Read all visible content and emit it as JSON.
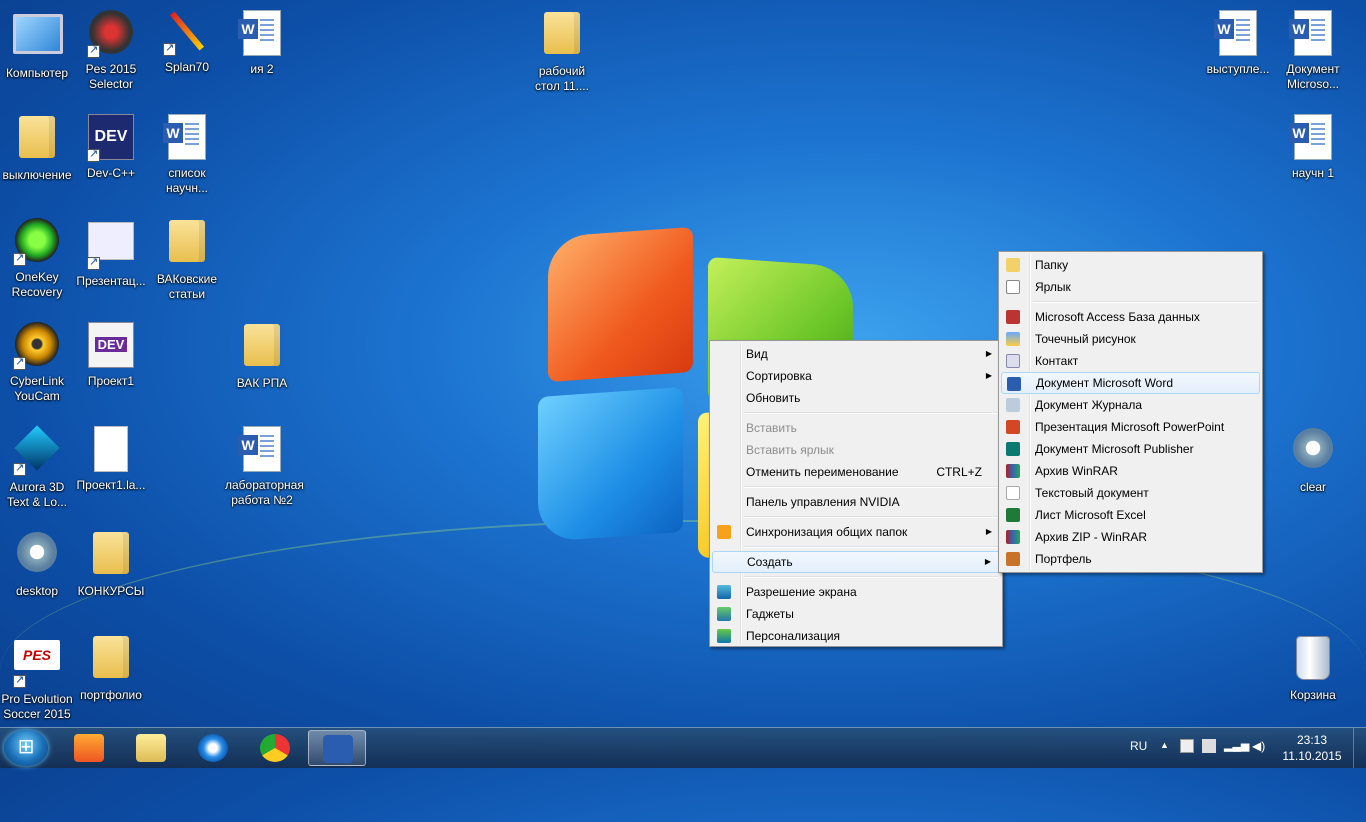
{
  "desktop": {
    "icons": [
      {
        "label": "Компьютер"
      },
      {
        "label": "Pes 2015 Selector"
      },
      {
        "label": "Splan70"
      },
      {
        "label": "ия 2"
      },
      {
        "label": "рабочий стол 11...."
      },
      {
        "label": "выступле..."
      },
      {
        "label": "Документ Microso..."
      },
      {
        "label": "выключение"
      },
      {
        "label": "Dev-C++"
      },
      {
        "label": "список научн..."
      },
      {
        "label": "научн 1"
      },
      {
        "label": "OneKey Recovery"
      },
      {
        "label": "Презентац..."
      },
      {
        "label": "ВАКовские статьи"
      },
      {
        "label": "CyberLink YouCam"
      },
      {
        "label": "Проект1"
      },
      {
        "label": "ВАК РПА"
      },
      {
        "label": "Aurora 3D Text & Lo..."
      },
      {
        "label": "Проект1.la..."
      },
      {
        "label": "лабораторная работа №2"
      },
      {
        "label": "clear"
      },
      {
        "label": "desktop"
      },
      {
        "label": "КОНКУРСЫ"
      },
      {
        "label": "Pro Evolution Soccer 2015"
      },
      {
        "label": "портфолио"
      },
      {
        "label": "Корзина"
      }
    ]
  },
  "context_menu": {
    "items": [
      {
        "label": "Вид"
      },
      {
        "label": "Сортировка"
      },
      {
        "label": "Обновить"
      },
      {
        "label": "Вставить"
      },
      {
        "label": "Вставить ярлык"
      },
      {
        "label": "Отменить переименование",
        "shortcut": "CTRL+Z"
      },
      {
        "label": "Панель управления NVIDIA"
      },
      {
        "label": "Синхронизация общих папок"
      },
      {
        "label": "Создать"
      },
      {
        "label": "Разрешение экрана"
      },
      {
        "label": "Гаджеты"
      },
      {
        "label": "Персонализация"
      }
    ]
  },
  "create_submenu": {
    "items": [
      {
        "label": "Папку"
      },
      {
        "label": "Ярлык"
      },
      {
        "label": "Microsoft Access База данных"
      },
      {
        "label": "Точечный рисунок"
      },
      {
        "label": "Контакт"
      },
      {
        "label": "Документ Microsoft Word"
      },
      {
        "label": "Документ Журнала"
      },
      {
        "label": "Презентация Microsoft PowerPoint"
      },
      {
        "label": "Документ Microsoft Publisher"
      },
      {
        "label": "Архив WinRAR"
      },
      {
        "label": "Текстовый документ"
      },
      {
        "label": "Лист Microsoft Excel"
      },
      {
        "label": "Архив ZIP - WinRAR"
      },
      {
        "label": "Портфель"
      }
    ]
  },
  "taskbar": {
    "language": "RU",
    "time": "23:13",
    "date": "11.10.2015"
  }
}
